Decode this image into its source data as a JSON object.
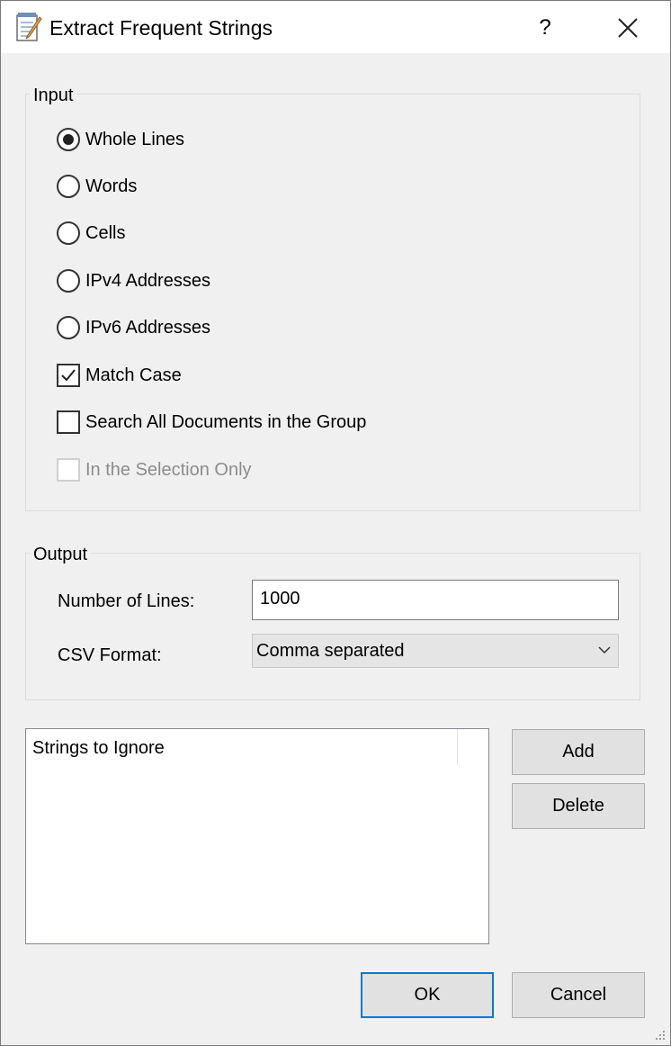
{
  "window": {
    "title": "Extract Frequent Strings",
    "help_label": "?"
  },
  "input_group": {
    "label": "Input",
    "options": [
      {
        "label": "Whole Lines",
        "type": "radio",
        "checked": true
      },
      {
        "label": "Words",
        "type": "radio",
        "checked": false
      },
      {
        "label": "Cells",
        "type": "radio",
        "checked": false
      },
      {
        "label": "IPv4 Addresses",
        "type": "radio",
        "checked": false
      },
      {
        "label": "IPv6 Addresses",
        "type": "radio",
        "checked": false
      },
      {
        "label": "Match Case",
        "type": "checkbox",
        "checked": true
      },
      {
        "label": "Search All Documents in the Group",
        "type": "checkbox",
        "checked": false
      },
      {
        "label": "In the Selection Only",
        "type": "checkbox",
        "checked": false,
        "disabled": true
      }
    ]
  },
  "output_group": {
    "label": "Output",
    "lines_label": "Number of Lines:",
    "lines_value": "1000",
    "csv_label": "CSV Format:",
    "csv_value": "Comma separated"
  },
  "ignore_list": {
    "header": "Strings to Ignore",
    "items": []
  },
  "buttons": {
    "add": "Add",
    "delete": "Delete",
    "ok": "OK",
    "cancel": "Cancel"
  },
  "colors": {
    "focus_border": "#0078d7",
    "dialog_bg": "#f0f0f0"
  }
}
